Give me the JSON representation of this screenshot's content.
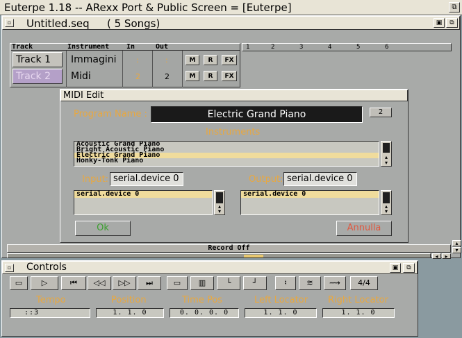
{
  "screen": {
    "title": "Euterpe 1.18 -- ARexx Port & Public Screen = [Euterpe]"
  },
  "seq_window": {
    "title": "Untitled.seq",
    "song_count": "( 5 Songs)",
    "headers": {
      "track": "Track",
      "instrument": "Instrument",
      "in": "In",
      "out": "Out"
    },
    "tracks": [
      {
        "name": "Track 1",
        "instrument": "Immagini",
        "in": ":",
        "out": ":"
      },
      {
        "name": "Track 2",
        "instrument": "Midi",
        "in": "2",
        "out": "2"
      }
    ],
    "button_labels": {
      "m": "M",
      "r": "R",
      "fx": "FX"
    },
    "ruler": [
      "1",
      "2",
      "3",
      "4",
      "5",
      "6"
    ],
    "record_status": "Record Off"
  },
  "midi_edit": {
    "title": "MIDI Edit",
    "program_name_label": "Program Name :",
    "program_name": "Electric Grand Piano",
    "program_number": "2",
    "instruments_label": "Instruments",
    "instruments": [
      "Acoustic Grand Piano",
      "Bright Acoustic Piano",
      "Electric Grand Piano",
      "Honky-Tonk Piano"
    ],
    "selected_instrument": "Electric Grand Piano",
    "input_label": "Input:",
    "input_value": "serial.device 0",
    "input_list": [
      "serial.device 0"
    ],
    "output_label": "Output:",
    "output_value": "serial.device 0",
    "output_list": [
      "serial.device 0"
    ],
    "ok_label": "Ok",
    "cancel_label": "Annulla"
  },
  "controls": {
    "title": "Controls",
    "time_signature": "4/4",
    "labels": {
      "tempo": "Tempo",
      "position": "Position",
      "time_pos": "Time Pos",
      "left_locator": "Left Locator",
      "right_locator": "Right Locator"
    },
    "values": {
      "tempo": "::3",
      "position": "1. 1. 0",
      "time_pos": "0. 0. 0. 0",
      "left_locator": "1. 1. 0",
      "right_locator": "1. 1. 0"
    }
  },
  "colors": {
    "accent": "#e8a840",
    "selected": "#f0dc9c",
    "panel": "#a8aaa8",
    "cancel": "#e05840"
  }
}
